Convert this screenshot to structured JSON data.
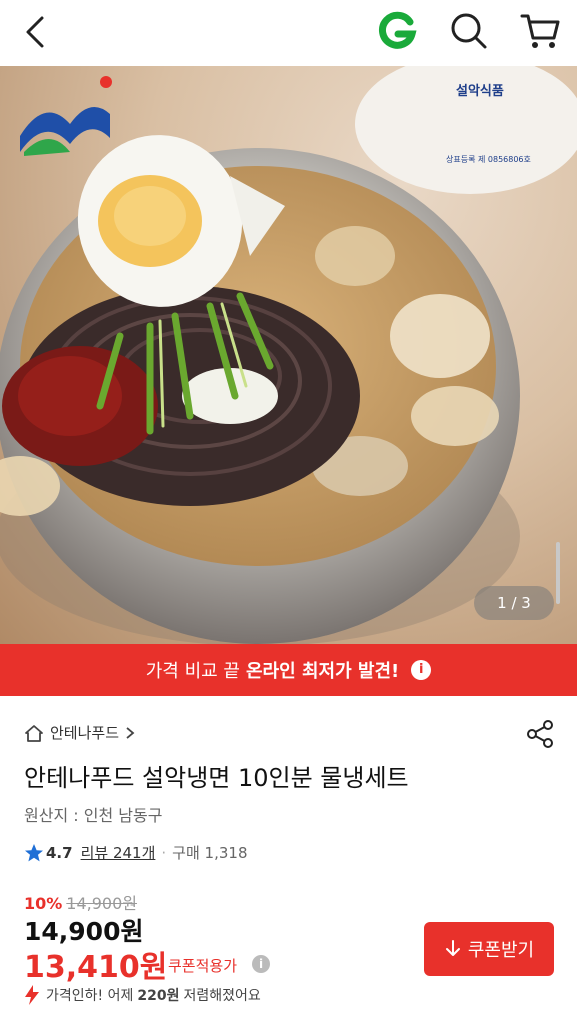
{
  "header": {
    "back_icon": "chevron-left-icon",
    "brand_icon": "g-logo-icon",
    "search_icon": "search-icon",
    "cart_icon": "cart-icon"
  },
  "hero": {
    "brand_badge": {
      "name": "설악식품",
      "registration": "상표등록 제 0856806호"
    },
    "pager": "1 / 3"
  },
  "banner": {
    "prefix": "가격 비교 끝",
    "highlight": "온라인 최저가 발견!",
    "info_icon": "info-icon"
  },
  "product": {
    "store": "안테나푸드",
    "title": "안테나푸드 설악냉면 10인분 물냉세트",
    "origin": "원산지 : 인천 남동구",
    "rating": "4.7",
    "review": "리뷰 241개",
    "purchases": "구매 1,318"
  },
  "pricing": {
    "discount_rate": "10%",
    "original_price": "14,900원",
    "price": "14,900원",
    "coupon_price": "13,410원",
    "coupon_label": "쿠폰적용가",
    "coupon_button": "쿠폰받기",
    "drop_note_prefix": "가격인하! 어제 ",
    "drop_note_amount": "220원",
    "drop_note_suffix": " 저렴해졌어요"
  },
  "colors": {
    "accent": "#e8312b",
    "brand_green": "#1aaa3a",
    "star": "#1f6fd6"
  }
}
